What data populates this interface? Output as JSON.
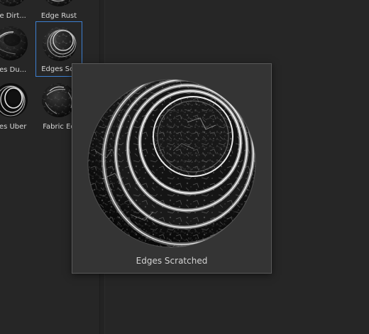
{
  "window": {
    "background": "#262626"
  },
  "material_grid": {
    "items": [
      {
        "label": "ge Dirt...",
        "icon": "edges-dirt-thumbnail"
      },
      {
        "label": "Edge Rust",
        "icon": "edge-rust-thumbnail"
      },
      {
        "label": "ges Du...",
        "icon": "edges-dust-thumbnail"
      },
      {
        "label": "Edges Scr",
        "icon": "edges-scratched-thumbnail",
        "selected": true
      },
      {
        "label": "ges Uber",
        "icon": "edges-uber-thumbnail"
      },
      {
        "label": "Fabric Ed",
        "icon": "fabric-edges-thumbnail"
      }
    ]
  },
  "preview_popup": {
    "caption": "Edges Scratched",
    "icon": "edges-scratched-sphere-preview"
  },
  "colors": {
    "selection": "#3d7fd1",
    "popup_bg": "#343434",
    "popup_border": "#595959",
    "text": "#d8d8d8"
  }
}
